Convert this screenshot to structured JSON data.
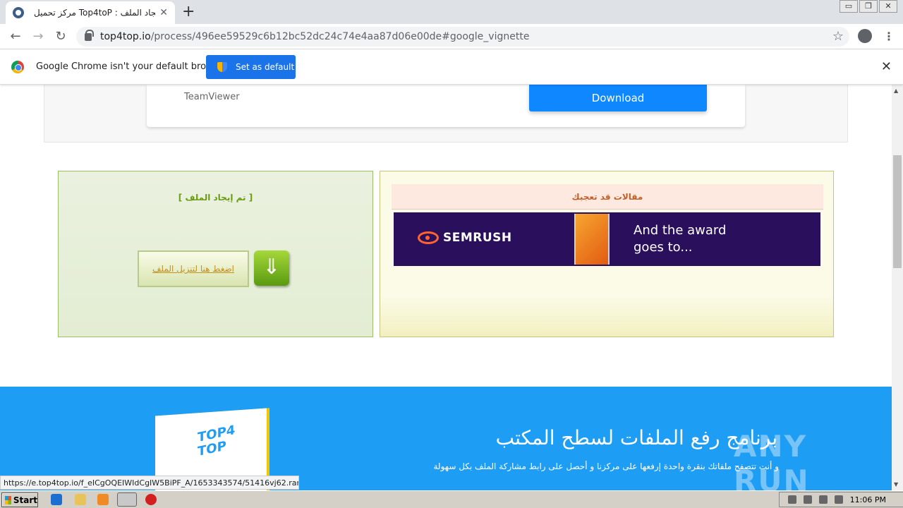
{
  "browser": {
    "tab_title": "مركز تحميل Top4toP : تم إيجاد الملف",
    "tab_close": "✕",
    "new_tab": "+",
    "url_host": "top4top.io",
    "url_path": "/process/496ee59529c6b12bc52dc24c74e4aa87d06e00de#google_vignette",
    "window_controls": [
      "▭",
      "❐",
      "✕"
    ]
  },
  "infobar": {
    "message": "Google Chrome isn't your default browser",
    "button_label": "Set as default",
    "close": "✕"
  },
  "download_card": {
    "app_name": "TeamViewer",
    "button_label": "Download"
  },
  "file_box": {
    "title": "[ تم إيجاد الملف ]",
    "download_link": "اضغط هنا لتنزيل الملف",
    "arrow_icon": "arrow-down-icon"
  },
  "articles": {
    "title": "مقالات قد تعجبك",
    "ad": {
      "brand": "SEMRUSH",
      "headline_1": "And the award",
      "headline_2": "goes to..."
    }
  },
  "footer": {
    "title": "برنامج رفع الملفات لسطح المكتب",
    "subtitle": "و أنت تتصفح ملفاتك بنقرة واحدة إرفعها على مركزنا و أحصل على رابط مشاركة الملف بكل سهولة",
    "logo_line1": "TOP4",
    "logo_line2": "TOP",
    "watermark": "ANY RUN",
    "accent_color": "#1e9df4"
  },
  "status_bar": {
    "url": "https://e.top4top.io/f_eICgOQEIWIdCgIW5BiPF_A/1653343574/51416vj62.rar"
  },
  "taskbar": {
    "start_label": "Start",
    "clock": "11:06 PM"
  }
}
